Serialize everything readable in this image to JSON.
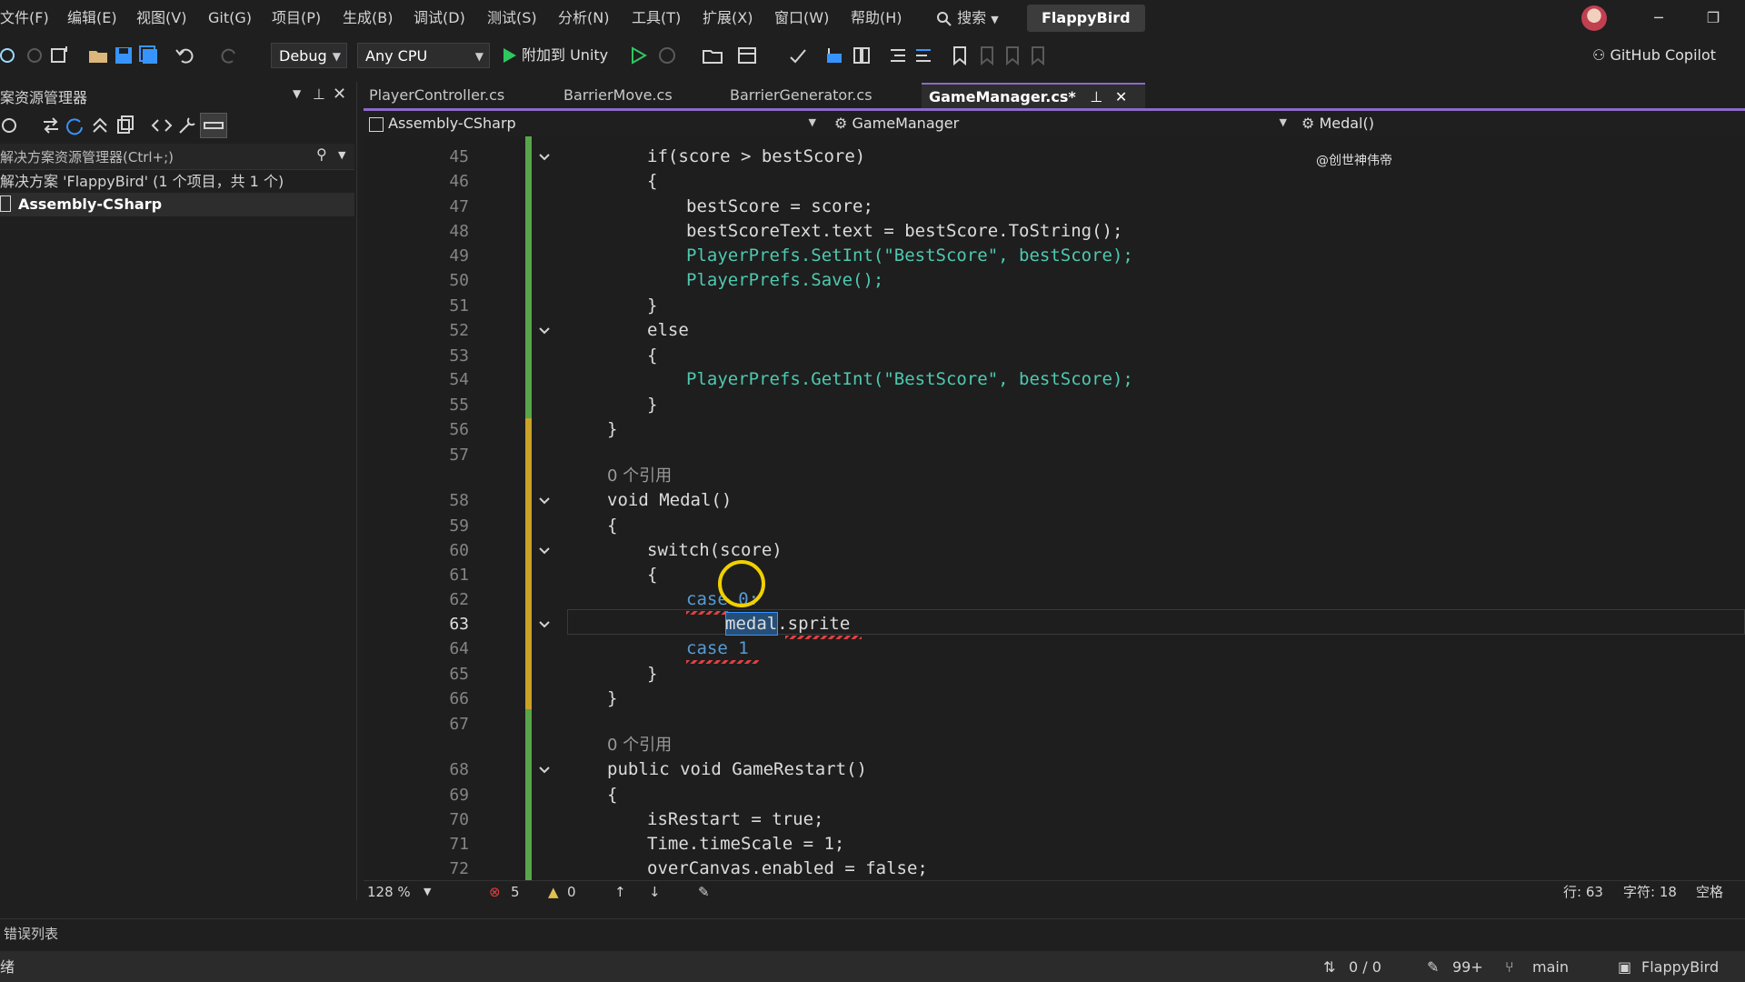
{
  "menu": [
    "文件(F)",
    "编辑(E)",
    "视图(V)",
    "Git(G)",
    "项目(P)",
    "生成(B)",
    "调试(D)",
    "测试(S)",
    "分析(N)",
    "工具(T)",
    "扩展(X)",
    "窗口(W)",
    "帮助(H)"
  ],
  "search_label": "搜索",
  "solution_name": "FlappyBird",
  "toolbar": {
    "config": "Debug",
    "platform": "Any CPU",
    "run_label": "附加到 Unity",
    "copilot": "GitHub Copilot"
  },
  "explorer": {
    "title": "案资源管理器",
    "search_placeholder": "解决方案资源管理器(Ctrl+;)",
    "solution_line": "解决方案 'FlappyBird' (1 个项目，共 1 个)",
    "project": "Assembly-CSharp"
  },
  "tabs": [
    "PlayerController.cs",
    "BarrierMove.cs",
    "BarrierGenerator.cs",
    "GameManager.cs*"
  ],
  "nav": {
    "project": "Assembly-CSharp",
    "class": "GameManager",
    "member": "Medal()"
  },
  "overlay_note": "@创世神伟帝",
  "code": {
    "lines": [
      {
        "n": "45",
        "text": "if(score > bestScore)"
      },
      {
        "n": "46",
        "text": "{"
      },
      {
        "n": "47",
        "text": "bestScore = score;"
      },
      {
        "n": "48",
        "text": "bestScoreText.text = bestScore.ToString();"
      },
      {
        "n": "49",
        "text": "PlayerPrefs.SetInt(\"BestScore\", bestScore);"
      },
      {
        "n": "50",
        "text": "PlayerPrefs.Save();"
      },
      {
        "n": "51",
        "text": "}"
      },
      {
        "n": "52",
        "text": "else"
      },
      {
        "n": "53",
        "text": "{"
      },
      {
        "n": "54",
        "text": "PlayerPrefs.GetInt(\"BestScore\", bestScore);"
      },
      {
        "n": "55",
        "text": "}"
      },
      {
        "n": "56",
        "text": "}"
      },
      {
        "n": "57",
        "text": ""
      },
      {
        "n": "58",
        "text": "void Medal()"
      },
      {
        "n": "59",
        "text": "{"
      },
      {
        "n": "60",
        "text": "switch(score)"
      },
      {
        "n": "61",
        "text": "{"
      },
      {
        "n": "62",
        "text": "case 0:"
      },
      {
        "n": "63",
        "text": "medal.sprite"
      },
      {
        "n": "64",
        "text": "case 1"
      },
      {
        "n": "65",
        "text": "}"
      },
      {
        "n": "66",
        "text": "}"
      },
      {
        "n": "67",
        "text": ""
      },
      {
        "n": "68",
        "text": "public void GameRestart()"
      },
      {
        "n": "69",
        "text": "{"
      },
      {
        "n": "70",
        "text": "isRestart = true;"
      },
      {
        "n": "71",
        "text": "Time.timeScale = 1;"
      },
      {
        "n": "72",
        "text": "overCanvas.enabled = false;"
      }
    ],
    "lens_medal": "0 个引用",
    "lens_restart": "0 个引用"
  },
  "editor_status": {
    "zoom": "128 %",
    "errors": "5",
    "warnings": "0",
    "line": "行: 63",
    "col": "字符: 18",
    "spacing": "空格"
  },
  "errorlist_title": "错误列表",
  "statusbar": {
    "left": "绪",
    "sync": "0 / 0",
    "changes": "99+",
    "branch": "main",
    "repo": "FlappyBird"
  },
  "colors": {
    "accent": "#8c6bc8",
    "change_saved": "#57a64a",
    "change_unsaved": "#c9a227",
    "error": "#e04040",
    "cursor_ring": "#f0d000"
  }
}
